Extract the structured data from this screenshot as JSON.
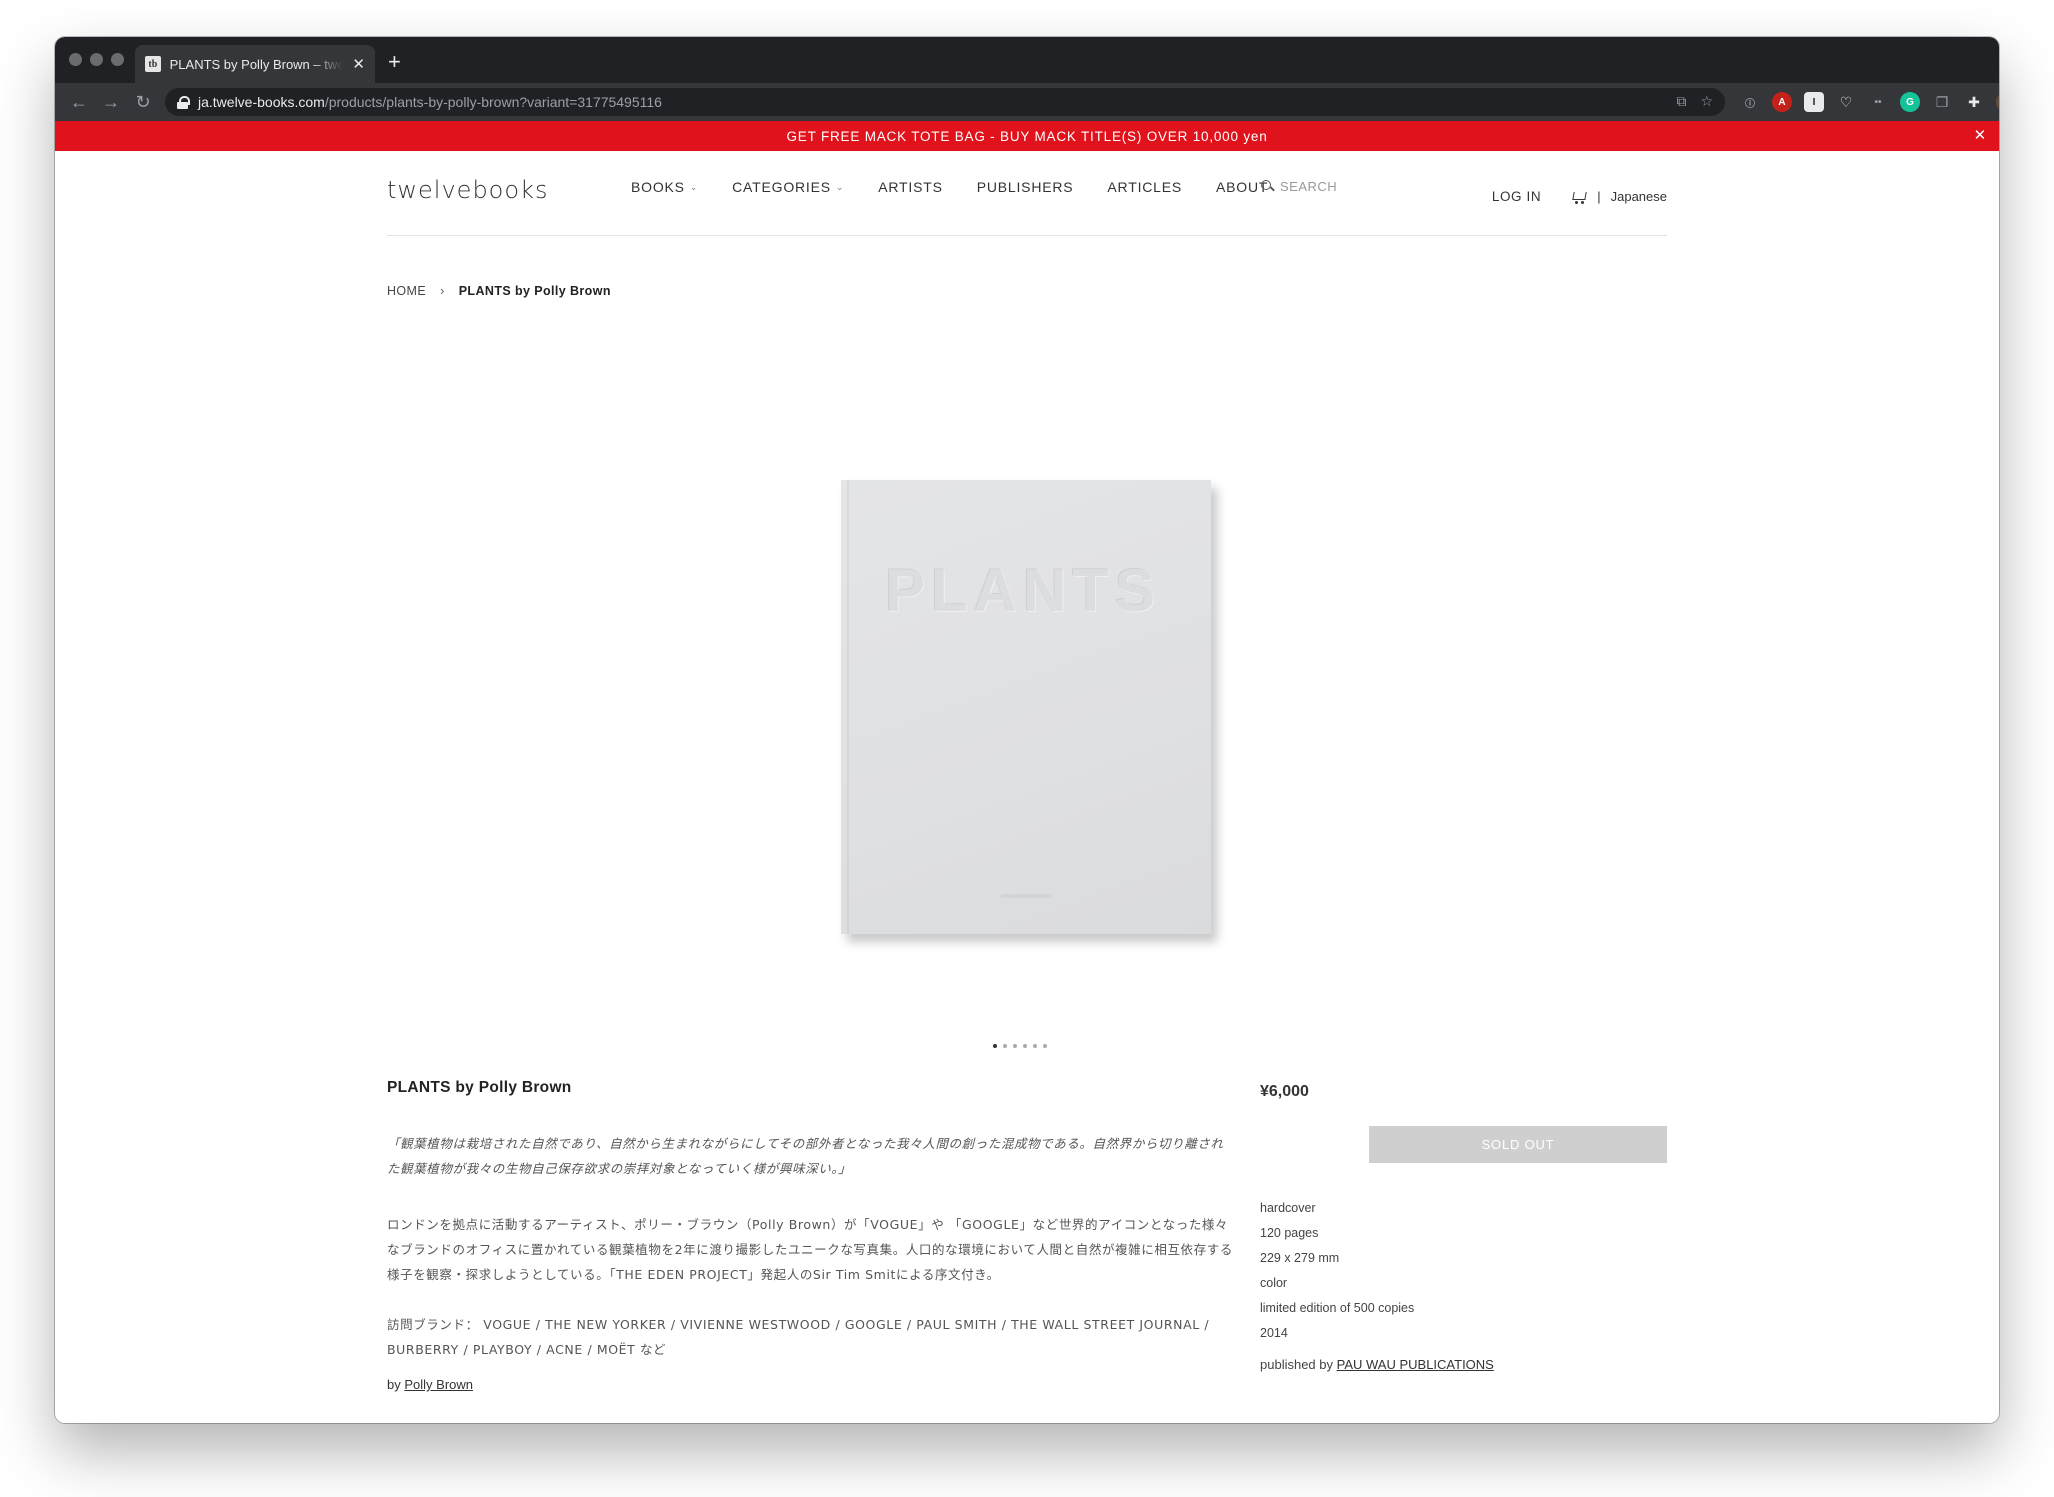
{
  "browser": {
    "tab_title": "PLANTS by Polly Brown – twelvebooks",
    "favicon_text": "tb",
    "url_host": "ja.twelve-books.com",
    "url_path": "/products/plants-by-polly-brown?variant=31775495116"
  },
  "promo": {
    "text": "GET FREE MACK TOTE BAG - BUY MACK TITLE(S) OVER 10,000 yen"
  },
  "header": {
    "logo": "twelvebooks",
    "nav": [
      "BOOKS",
      "CATEGORIES",
      "ARTISTS",
      "PUBLISHERS",
      "ARTICLES",
      "ABOUT"
    ],
    "search_placeholder": "SEARCH",
    "login": "LOG IN",
    "divider": "|",
    "language": "Japanese"
  },
  "breadcrumb": {
    "home": "HOME",
    "separator": "›",
    "current": "PLANTS by Polly Brown"
  },
  "product": {
    "cover_text": "PLANTS",
    "image_count": 6,
    "active_image": 1,
    "title": "PLANTS by Polly Brown",
    "quote": "「観葉植物は栽培された自然であり、自然から生まれながらにしてその部外者となった我々人間の創った混成物である。自然界から切り離された観葉植物が我々の生物自己保存欲求の崇拝対象となっていく様が興味深い。」",
    "description": "ロンドンを拠点に活動するアーティスト、ポリー・ブラウン（Polly Brown）が「VOGUE」や 「GOOGLE」など世界的アイコンとなった様々なブランドのオフィスに置かれている観葉植物を2年に渡り撮影したユニークな写真集。人口的な環境において人間と自然が複雑に相互依存する様子を観察・探求しようとしている。「THE EDEN PROJECT」発起人のSir Tim Smitによる序文付き。",
    "brands": "訪問ブランド： VOGUE / THE NEW YORKER / VIVIENNE WESTWOOD / GOOGLE / PAUL SMITH / THE WALL STREET JOURNAL / BURBERRY / PLAYBOY / ACNE / MOËT など",
    "by_prefix": "by",
    "author": "Polly Brown",
    "price": "¥6,000",
    "sold_out": "SOLD OUT",
    "specs": [
      "hardcover",
      "120 pages",
      "229 x 279 mm",
      "color",
      "limited edition of 500 copies",
      "2014"
    ],
    "published_prefix": "published by",
    "publisher": "PAU WAU PUBLICATIONS"
  },
  "colors": {
    "promo_bg": "#e0121b",
    "sold_out_bg": "#cfcfcf"
  }
}
